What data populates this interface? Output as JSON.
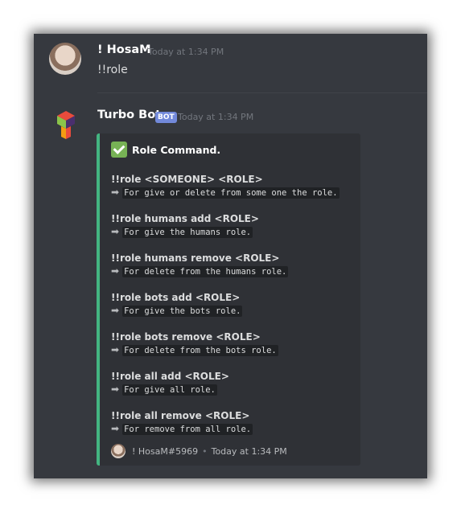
{
  "message1": {
    "username": "! HosaM",
    "timestamp": "Today at 1:34 PM",
    "content": "!!role"
  },
  "message2": {
    "username": "Turbo Bot",
    "badge": "BOT",
    "timestamp": "Today at 1:34 PM",
    "embed": {
      "title": "Role Command.",
      "accent_color": "#43b581",
      "fields": [
        {
          "name": "!!role <SOMEONE> <ROLE>",
          "value": "For give or delete from some one the role."
        },
        {
          "name": "!!role humans add <ROLE>",
          "value": "For give the humans role."
        },
        {
          "name": "!!role humans remove <ROLE>",
          "value": "For delete from the humans role."
        },
        {
          "name": "!!role bots add <ROLE>",
          "value": "For give the bots role."
        },
        {
          "name": "!!role bots remove <ROLE>",
          "value": "For delete from the bots role."
        },
        {
          "name": "!!role all add <ROLE>",
          "value": "For give all role."
        },
        {
          "name": "!!role all remove <ROLE>",
          "value": "For remove from all role."
        }
      ],
      "footer": {
        "author": "! HosaM#5969",
        "timestamp": "Today at 1:34 PM"
      }
    }
  }
}
